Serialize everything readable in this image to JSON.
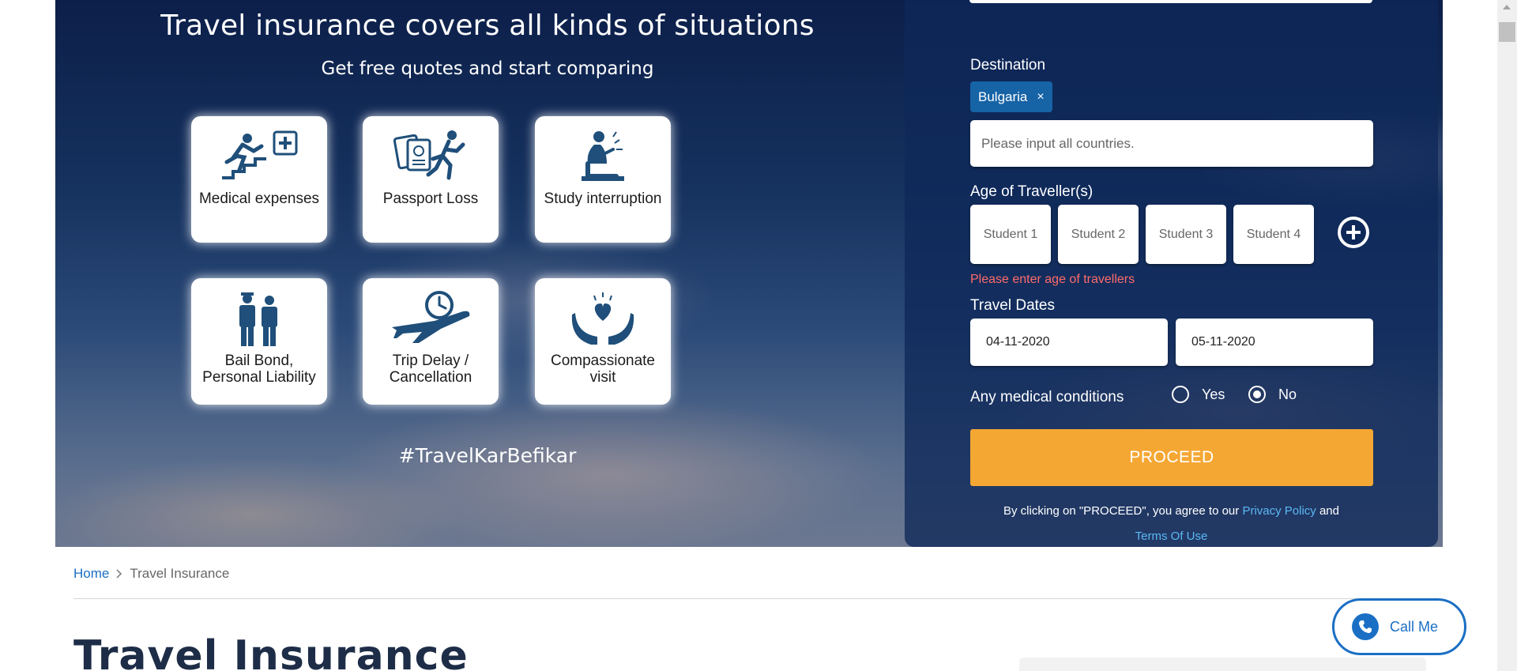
{
  "hero": {
    "title": "Travel insurance covers all kinds of situations",
    "subtitle": "Get free quotes and start comparing",
    "hashtag": "#TravelKarBefikar",
    "cards": [
      {
        "label": "Medical expenses",
        "icon": "medical-fall-icon"
      },
      {
        "label": "Passport Loss",
        "icon": "passport-loss-icon"
      },
      {
        "label": "Study interruption",
        "icon": "study-interruption-icon"
      },
      {
        "label_line1": "Bail Bond,",
        "label_line2": "Personal Liability",
        "icon": "bail-bond-icon"
      },
      {
        "label_line1": "Trip Delay /",
        "label_line2": "Cancellation",
        "icon": "trip-delay-icon"
      },
      {
        "label_line1": "Compassionate",
        "label_line2": "visit",
        "icon": "compassionate-visit-icon"
      }
    ]
  },
  "form": {
    "destination_label": "Destination",
    "destination_chip": "Bulgaria",
    "destination_chip_remove": "×",
    "countries_placeholder": "Please input all countries.",
    "age_label": "Age of Traveller(s)",
    "age_boxes": [
      "Student 1",
      "Student 2",
      "Student 3",
      "Student 4"
    ],
    "age_error": "Please enter age of travellers",
    "dates_label": "Travel Dates",
    "date_from": "04-11-2020",
    "date_to": "05-11-2020",
    "medical_label": "Any medical conditions",
    "medical_yes": "Yes",
    "medical_no": "No",
    "medical_selected": "No",
    "proceed_label": "PROCEED",
    "agree_text": "By clicking on \"PROCEED\", you agree to our",
    "privacy_link": "Privacy Policy",
    "and_text": "and",
    "terms_link": "Terms Of Use"
  },
  "breadcrumb": {
    "home": "Home",
    "separator": ">",
    "current": "Travel Insurance"
  },
  "page": {
    "heading": "Travel Insurance"
  },
  "callme": {
    "label": "Call Me"
  },
  "colors": {
    "accent": "#f5a733",
    "link": "#1a6fc4",
    "error": "#ff6b6b",
    "panel": "#0e2858"
  }
}
